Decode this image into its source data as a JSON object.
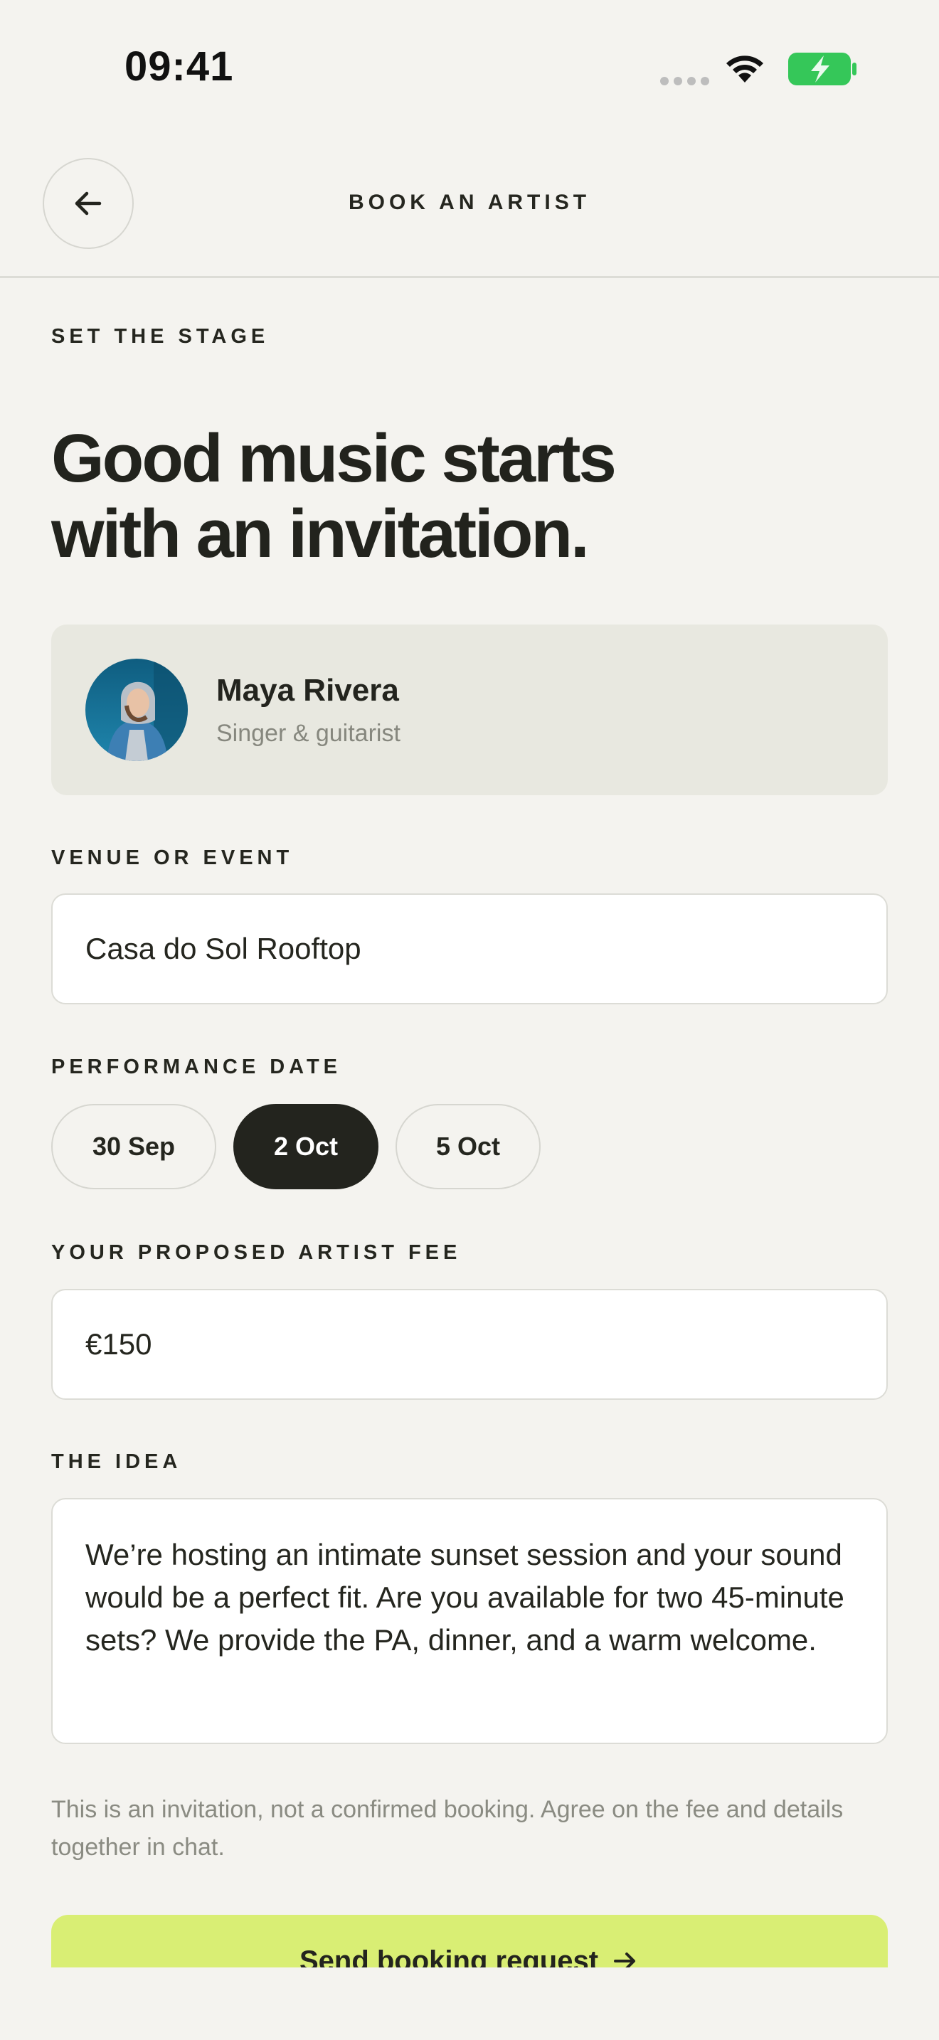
{
  "status_bar": {
    "time": "09:41",
    "battery_color": "#35c759"
  },
  "header": {
    "title": "BOOK AN ARTIST",
    "back_icon": "arrow-left-icon"
  },
  "intro": {
    "eyebrow": "SET THE STAGE",
    "headline_line1": "Good music starts",
    "headline_line2": "with an invitation."
  },
  "artist": {
    "name": "Maya Rivera",
    "role": "Singer & guitarist"
  },
  "venue": {
    "label": "VENUE OR EVENT",
    "value": "Casa do Sol Rooftop"
  },
  "date": {
    "label": "PERFORMANCE DATE",
    "options": [
      "30 Sep",
      "2 Oct",
      "5 Oct"
    ],
    "selected": "2 Oct"
  },
  "fee": {
    "label": "YOUR PROPOSED ARTIST FEE",
    "value": "€150"
  },
  "idea": {
    "label": "THE IDEA",
    "value": "We’re hosting an intimate sunset session and your sound would be a perfect fit. Are you available for two 45-minute sets? We provide the PA, dinner, and a warm welcome."
  },
  "disclaimer": "This is an invitation, not a confirmed booking. Agree on the fee and details together in chat.",
  "cta": {
    "label": "Send booking request",
    "icon": "arrow-right-icon",
    "color": "#d9ee74"
  }
}
